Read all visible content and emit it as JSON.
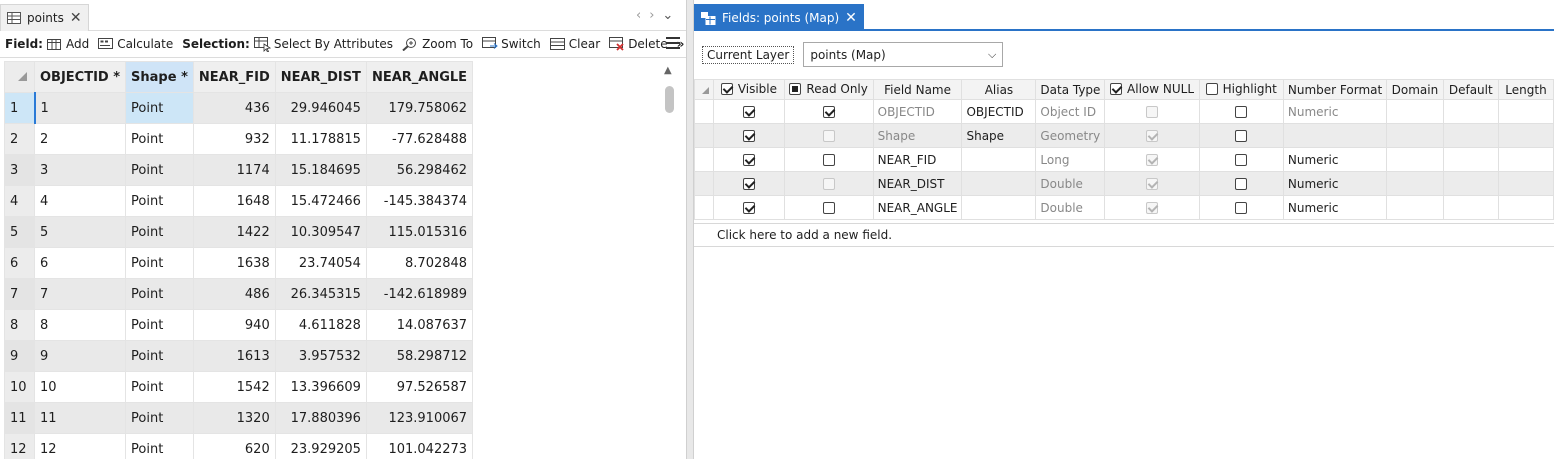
{
  "left_tab": {
    "label": "points"
  },
  "toolbar": {
    "field_label": "Field:",
    "add": "Add",
    "calculate": "Calculate",
    "selection_label": "Selection:",
    "select_by_attributes": "Select By Attributes",
    "zoom_to": "Zoom To",
    "switch": "Switch",
    "clear": "Clear",
    "delete": "Delete",
    "more": "»"
  },
  "attribute_table": {
    "columns": [
      "OBJECTID *",
      "Shape *",
      "NEAR_FID",
      "NEAR_DIST",
      "NEAR_ANGLE"
    ],
    "rows": [
      [
        "1",
        "1",
        "Point",
        "436",
        "29.946045",
        "179.758062"
      ],
      [
        "2",
        "2",
        "Point",
        "932",
        "11.178815",
        "-77.628488"
      ],
      [
        "3",
        "3",
        "Point",
        "1174",
        "15.184695",
        "56.298462"
      ],
      [
        "4",
        "4",
        "Point",
        "1648",
        "15.472466",
        "-145.384374"
      ],
      [
        "5",
        "5",
        "Point",
        "1422",
        "10.309547",
        "115.015316"
      ],
      [
        "6",
        "6",
        "Point",
        "1638",
        "23.74054",
        "8.702848"
      ],
      [
        "7",
        "7",
        "Point",
        "486",
        "26.345315",
        "-142.618989"
      ],
      [
        "8",
        "8",
        "Point",
        "940",
        "4.611828",
        "14.087637"
      ],
      [
        "9",
        "9",
        "Point",
        "1613",
        "3.957532",
        "58.298712"
      ],
      [
        "10",
        "10",
        "Point",
        "1542",
        "13.396609",
        "97.526587"
      ],
      [
        "11",
        "11",
        "Point",
        "1320",
        "17.880396",
        "123.910067"
      ],
      [
        "12",
        "12",
        "Point",
        "620",
        "23.929205",
        "101.042273"
      ]
    ]
  },
  "right_tab": {
    "label": "Fields: points (Map)"
  },
  "current_layer": {
    "label": "Current Layer",
    "value": "points (Map)"
  },
  "fields_table": {
    "headers": {
      "visible": "Visible",
      "read_only": "Read Only",
      "field_name": "Field Name",
      "alias": "Alias",
      "data_type": "Data Type",
      "allow_null": "Allow NULL",
      "highlight": "Highlight",
      "number_format": "Number Format",
      "domain": "Domain",
      "default": "Default",
      "length": "Length"
    },
    "rows": [
      {
        "field_name": "OBJECTID",
        "alias": "OBJECTID",
        "data_type": "Object ID",
        "number_format": "Numeric"
      },
      {
        "field_name": "Shape",
        "alias": "Shape",
        "data_type": "Geometry",
        "number_format": ""
      },
      {
        "field_name": "NEAR_FID",
        "alias": "",
        "data_type": "Long",
        "number_format": "Numeric"
      },
      {
        "field_name": "NEAR_DIST",
        "alias": "",
        "data_type": "Double",
        "number_format": "Numeric"
      },
      {
        "field_name": "NEAR_ANGLE",
        "alias": "",
        "data_type": "Double",
        "number_format": "Numeric"
      }
    ],
    "add_field": "Click here to add a new field."
  },
  "colors": {
    "accent": "#2a73c7",
    "selection": "#cde6f7"
  }
}
